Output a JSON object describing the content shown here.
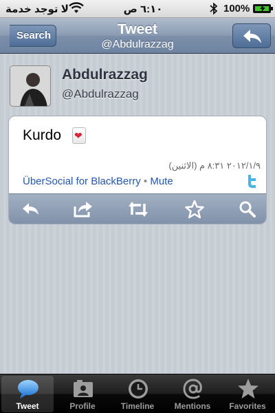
{
  "status_bar": {
    "carrier": "لا توجد خدمة",
    "time": "٦:١٠ ص",
    "battery": "100%"
  },
  "nav": {
    "back_label": "Search",
    "title": "Tweet",
    "subtitle": "@Abdulrazzag"
  },
  "user": {
    "name": "Abdulrazzag",
    "handle": "@Abdulrazzag"
  },
  "tweet": {
    "text": "Kurdo",
    "date": "٢٠١٢/١/٩ ٨:٣١ م (الاثنين)",
    "client": "ÜberSocial for BlackBerry",
    "separator": "•",
    "mute": "Mute"
  },
  "tabs": [
    {
      "label": "Tweet",
      "icon": "speech-bubble-icon",
      "active": true
    },
    {
      "label": "Profile",
      "icon": "profile-card-icon",
      "active": false
    },
    {
      "label": "Timeline",
      "icon": "clock-icon",
      "active": false
    },
    {
      "label": "Mentions",
      "icon": "at-sign-icon",
      "active": false
    },
    {
      "label": "Favorites",
      "icon": "star-icon",
      "active": false
    }
  ],
  "colors": {
    "nav_bar": "#7d8fa9",
    "link": "#2458b0",
    "battery_fill": "#3fc52a",
    "active_tab": "#3a8fe0"
  }
}
